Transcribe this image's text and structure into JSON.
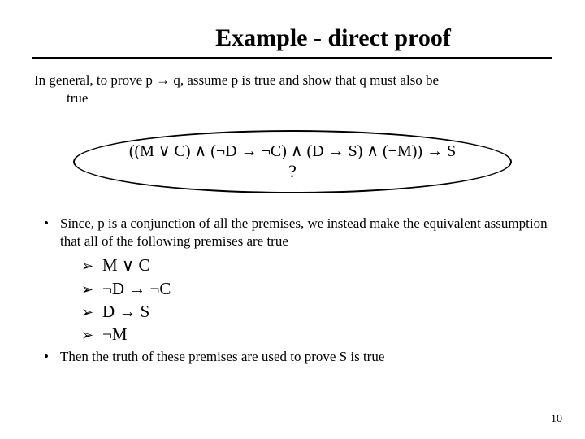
{
  "title": "Example - direct proof",
  "intro_line1": "In general, to prove p → q, assume p is true and show that q must also be",
  "intro_line2": "true",
  "formula": "((M ∨ C) ∧ (¬D → ¬C) ∧ (D → S) ∧ (¬M)) → S",
  "qmark": "?",
  "bullet1": "Since, p is a conjunction of all the premises, we instead make the equivalent assumption that all of the following premises are true",
  "premises": {
    "p1": "M ∨ C",
    "p2": "¬D → ¬C",
    "p3": "D → S",
    "p4": "¬M"
  },
  "bullet2": "Then the truth of these premises are used to prove S is true",
  "page_number": "10",
  "markers": {
    "bullet": "•",
    "arrow": "➢"
  }
}
